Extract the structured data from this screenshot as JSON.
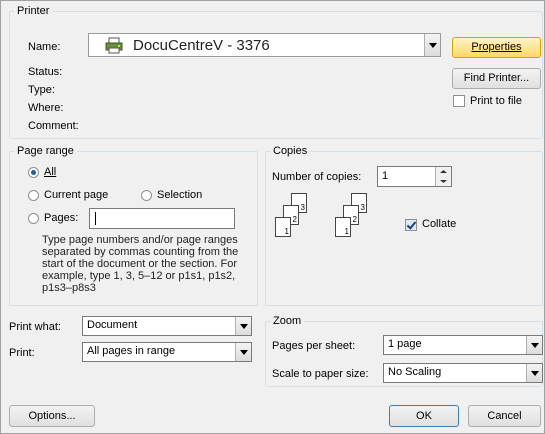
{
  "printer": {
    "legend": "Printer",
    "name_label": "Name:",
    "name_value": "DocuCentreV - 3376",
    "status_label": "Status:",
    "type_label": "Type:",
    "where_label": "Where:",
    "comment_label": "Comment:",
    "properties_label": "Properties",
    "find_printer_label": "Find Printer...",
    "print_to_file_label": "Print to file",
    "print_to_file_checked": false
  },
  "page_range": {
    "legend": "Page range",
    "all_label": "All",
    "current_page_label": "Current page",
    "selection_label": "Selection",
    "pages_label": "Pages:",
    "pages_value": "",
    "selected": "All",
    "help_text": "Type page numbers and/or page ranges separated by commas counting from the start of the document or the section. For example, type 1, 3, 5–12 or p1s1, p1s2, p1s3–p8s3"
  },
  "copies": {
    "legend": "Copies",
    "number_label": "Number of copies:",
    "number_value": "1",
    "collate_label": "Collate",
    "collate_checked": true,
    "page_numbers": [
      "3",
      "2",
      "1"
    ]
  },
  "print_what": {
    "label": "Print what:",
    "value": "Document"
  },
  "print": {
    "label": "Print:",
    "value": "All pages in range"
  },
  "zoom": {
    "legend": "Zoom",
    "pages_per_sheet_label": "Pages per sheet:",
    "pages_per_sheet_value": "1 page",
    "scale_label": "Scale to paper size:",
    "scale_value": "No Scaling"
  },
  "footer": {
    "options_label": "Options...",
    "ok_label": "OK",
    "cancel_label": "Cancel"
  },
  "icons": {
    "printer": "printer-icon",
    "spin_up": "spin-up-icon",
    "spin_down": "spin-down-icon",
    "dropdown": "chevron-down-icon"
  }
}
